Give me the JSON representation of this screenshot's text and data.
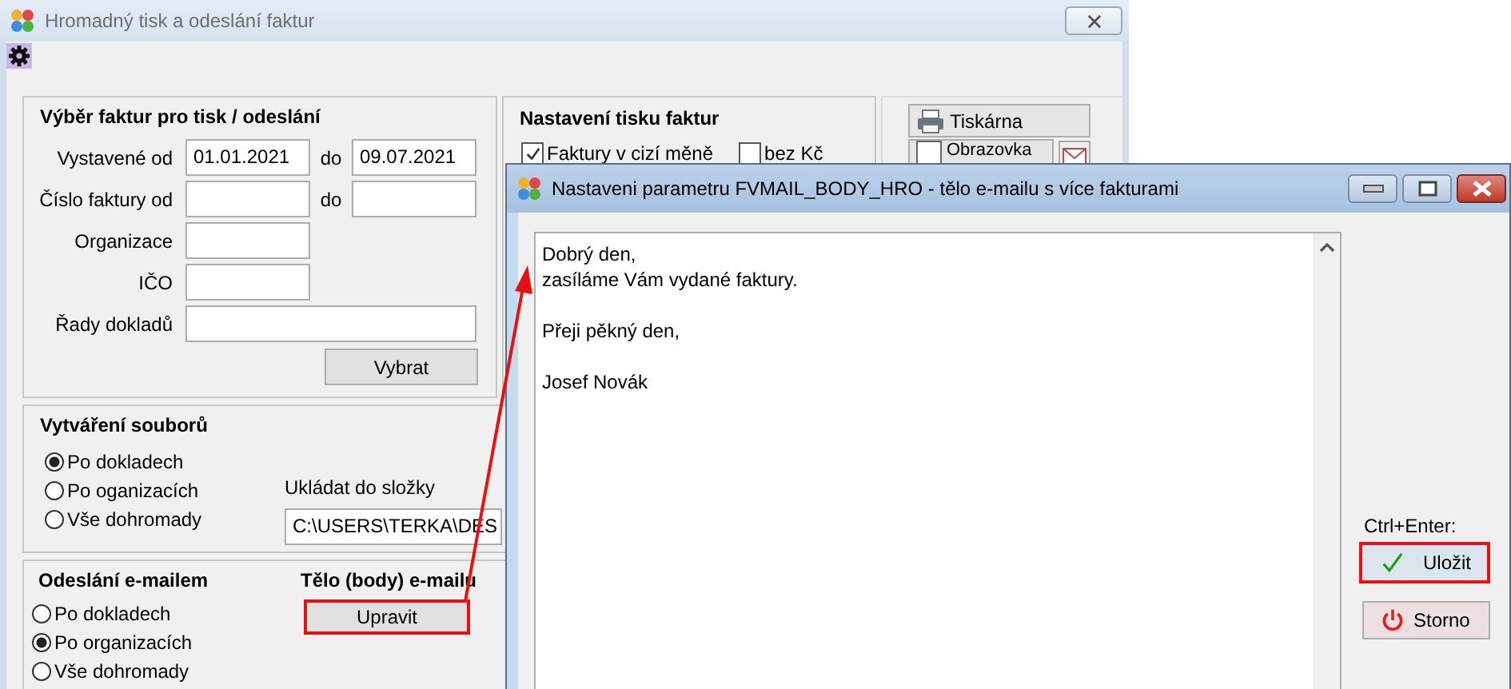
{
  "main_window": {
    "title": "Hromadný tisk a odeslání faktur"
  },
  "selection": {
    "title": "Výběr faktur pro tisk / odeslání",
    "rows": [
      {
        "kind": "range",
        "label": "Vystavené od",
        "from_value": "01.01.2021",
        "to_label": "do",
        "to_value": "09.07.2021"
      },
      {
        "kind": "range",
        "label": "Číslo faktury od",
        "to_label": "do"
      },
      {
        "kind": "short",
        "label": "Organizace"
      },
      {
        "kind": "short",
        "label": "IČO"
      },
      {
        "kind": "long",
        "label": "Řady dokladů"
      }
    ],
    "apply_button": "Vybrat"
  },
  "print_settings": {
    "title": "Nastavení tisku faktur",
    "checkboxes": [
      {
        "label": "Faktury v cizí měně",
        "checked": true
      },
      {
        "label": "bez Kč",
        "checked": false
      }
    ]
  },
  "output_buttons": [
    {
      "label": "Tiskárna"
    },
    {
      "label": "Obrazovka"
    }
  ],
  "file_creation": {
    "title": "Vytváření souborů",
    "options": [
      {
        "label": "Po dokladech",
        "selected": true
      },
      {
        "label": "Po oganizacích",
        "selected": false
      },
      {
        "label": "Vše dohromady",
        "selected": false
      }
    ],
    "folder_label": "Ukládat do složky",
    "folder_value": "C:\\USERS\\TERKA\\DES"
  },
  "email_sending": {
    "title": "Odeslání e-mailem",
    "options": [
      {
        "label": "Po dokladech",
        "selected": false
      },
      {
        "label": "Po organizacích",
        "selected": true
      },
      {
        "label": "Vše dohromady",
        "selected": false
      }
    ],
    "body_label": "Tělo (body) e-mailu",
    "edit_button": {
      "label": "Upravit",
      "highlighted": true
    }
  },
  "dialog": {
    "title": "Nastaveni parametru FVMAIL_BODY_HRO - tělo e-mailu s více fakturami",
    "body_text": "Dobrý den,\nzasíláme Vám vydané faktury.\n\nPřeji pěkný den,\n\nJosef Novák",
    "shortcut_label": "Ctrl+Enter:",
    "save_button": {
      "label": "Uložit",
      "highlighted": true
    },
    "cancel_button": {
      "label": "Storno",
      "highlighted": false
    }
  }
}
